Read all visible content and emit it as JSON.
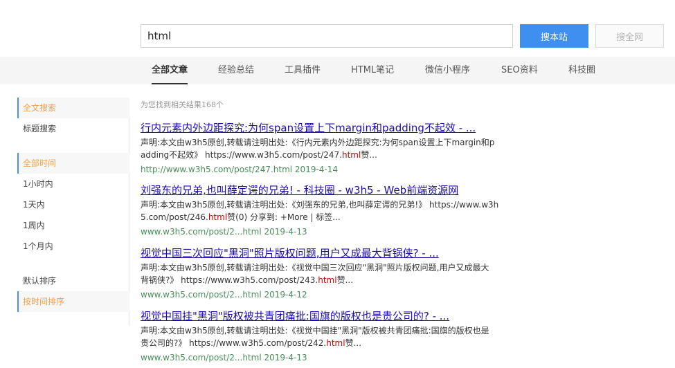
{
  "search": {
    "value": "html",
    "site_button": "搜本站",
    "all_button": "搜全网"
  },
  "nav": [
    "全部文章",
    "经验总结",
    "工具插件",
    "HTML笔记",
    "微信小程序",
    "SEO资料",
    "科技圈"
  ],
  "sidebar": [
    "全文搜索",
    "标题搜索",
    "全部时间",
    "1小时内",
    "1天内",
    "1周内",
    "1个月内",
    "默认排序",
    "按时间排序"
  ],
  "results_count": "为您找到相关结果168个",
  "results": [
    {
      "title": "行内元素内外边距探究:为何span设置上下margin和padding不起效 - ...",
      "desc_line1": "声明:本文由w3h5原创,转载请注明出处:《行内元素内外边距探究:为何span设置上下margin和p",
      "desc_line2_a": "adding不起效》 https://www.w3h5.com/post/247.",
      "desc_line2_hl": "html",
      "desc_line2_b": "赞...",
      "url": "http://www.w3h5.com/post/247.html 2019-4-14"
    },
    {
      "title": "刘强东的兄弟,也叫薛定谔的兄弟! - 科技圈 - w3h5 - Web前端资源网",
      "desc_line1": "声明:本文由w3h5原创,转载请注明出处:《刘强东的兄弟,也叫薛定谔的兄弟!》 https://www.w3h",
      "desc_line2_a": "5.com/post/246.",
      "desc_line2_hl": "html",
      "desc_line2_b": "赞(0) 分享到: +More | 标签...",
      "url": "www.w3h5.com/post/2...html 2019-4-13"
    },
    {
      "title": "视觉中国三次回应\"黑洞\"照片版权问题,用户又成最大背锅侠? - ...",
      "desc_line1": "声明:本文由w3h5原创,转载请注明出处:《视觉中国三次回应\"黑洞\"照片版权问题,用户又成最大",
      "desc_line2_a": "背锅侠?》 https://www.w3h5.com/post/243.",
      "desc_line2_hl": "html",
      "desc_line2_b": "赞...",
      "url": "www.w3h5.com/post/2...html 2019-4-12"
    },
    {
      "title": "视觉中国挂\"黑洞\"版权被共青团痛批:国旗的版权也是贵公司的? - ...",
      "desc_line1": "声明:本文由w3h5原创,转载请注明出处:《视觉中国挂\"黑洞\"版权被共青团痛批:国旗的版权也是",
      "desc_line2_a": "贵公司的?》 https://www.w3h5.com/post/242.",
      "desc_line2_hl": "html",
      "desc_line2_b": "赞...",
      "url": "www.w3h5.com/post/2...html 2019-4-13"
    }
  ]
}
